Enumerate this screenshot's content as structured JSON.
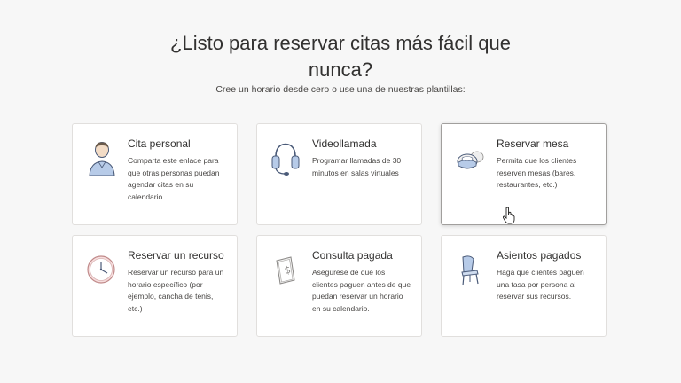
{
  "header": {
    "title_line1": "¿Listo para reservar citas más fácil que",
    "title_line2": "nunca?",
    "subtitle": "Cree un horario desde cero o use una de nuestras plantillas:"
  },
  "cards": [
    {
      "title": "Cita personal",
      "description": "Comparta este enlace para que otras personas puedan agendar citas en su calendario.",
      "icon": "person-icon"
    },
    {
      "title": "Videollamada",
      "description": "Programar llamadas de 30 minutos en salas virtuales",
      "icon": "headset-icon"
    },
    {
      "title": "Reservar mesa",
      "description": "Permita que los clientes reserven mesas (bares, restaurantes, etc.)",
      "icon": "dining-table-icon"
    },
    {
      "title": "Reservar un recurso",
      "description": "Reservar un recurso para un horario específico (por ejemplo, cancha de tenis, etc.)",
      "icon": "clock-icon"
    },
    {
      "title": "Consulta pagada",
      "description": "Asegúrese de que los clientes paguen antes de que puedan reservar un horario en su calendario.",
      "icon": "payment-receipt-icon"
    },
    {
      "title": "Asientos pagados",
      "description": "Haga que clientes paguen una tasa por persona al reservar sus recursos.",
      "icon": "chair-icon"
    }
  ],
  "colors": {
    "background": "#f7f7f7",
    "card_background": "#ffffff",
    "card_border": "#e1dfdd",
    "icon_blue": "#b7cbe8",
    "icon_dark": "#4a5a78"
  }
}
